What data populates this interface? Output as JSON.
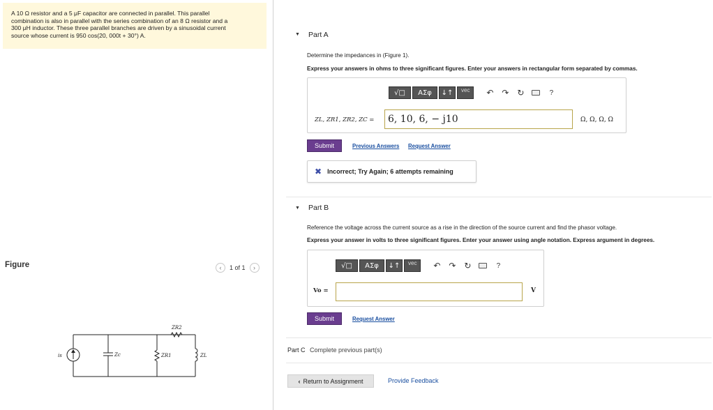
{
  "problem": {
    "lines": [
      "A 10 Ω resistor and a 5 μF capacitor are connected in parallel. This parallel",
      "combination is also in parallel with the series combination of an 8 Ω resistor and a",
      "300 μH inductor. These three parallel branches are driven by a sinusoidal current",
      "source whose current is 950 cos(20, 000t + 30°) A."
    ]
  },
  "figure": {
    "label": "Figure",
    "pager": "1 of 1",
    "prev_icon": "chevron-left-icon",
    "next_icon": "chevron-right-icon",
    "labels": {
      "source": "is",
      "zc": "Zc",
      "zr1": "ZR1",
      "zr2": "ZR2",
      "zl": "ZL"
    }
  },
  "partA": {
    "title": "Part A",
    "instruction": "Determine the impedances in (Figure 1).",
    "express": "Express your answers in ohms to three significant figures. Enter your answers in rectangular form separated by commas.",
    "toolbar": {
      "templates": "√□",
      "greek": "ΑΣφ",
      "arrows": "↓↑",
      "vec": "vec",
      "undo": "↶",
      "redo": "↷",
      "reset": "↻",
      "help": "?"
    },
    "math_label": "ZL, ZR1, ZR2, ZC =",
    "answer": "6, 10, 6, − j10",
    "units": "Ω, Ω, Ω, Ω",
    "submit": "Submit",
    "previous_answers": "Previous Answers",
    "request_answer": "Request Answer",
    "feedback": "Incorrect; Try Again; 6 attempts remaining"
  },
  "partB": {
    "title": "Part B",
    "instruction": "Reference the voltage across the current source as a rise in the direction of the source current and find the phasor voltage.",
    "express": "Express your answer in volts to three significant figures. Enter your answer using angle notation. Express argument in degrees.",
    "toolbar": {
      "templates": "√□",
      "greek": "ΑΣφ",
      "arrows": "↓↑",
      "vec": "vec",
      "undo": "↶",
      "redo": "↷",
      "reset": "↻",
      "help": "?"
    },
    "math_label": "Vo =",
    "answer": "",
    "units": "V",
    "submit": "Submit",
    "request_answer": "Request Answer"
  },
  "partC": {
    "title": "Part C",
    "status": "Complete previous part(s)"
  },
  "footer": {
    "return": "Return to Assignment",
    "feedback": "Provide Feedback"
  }
}
